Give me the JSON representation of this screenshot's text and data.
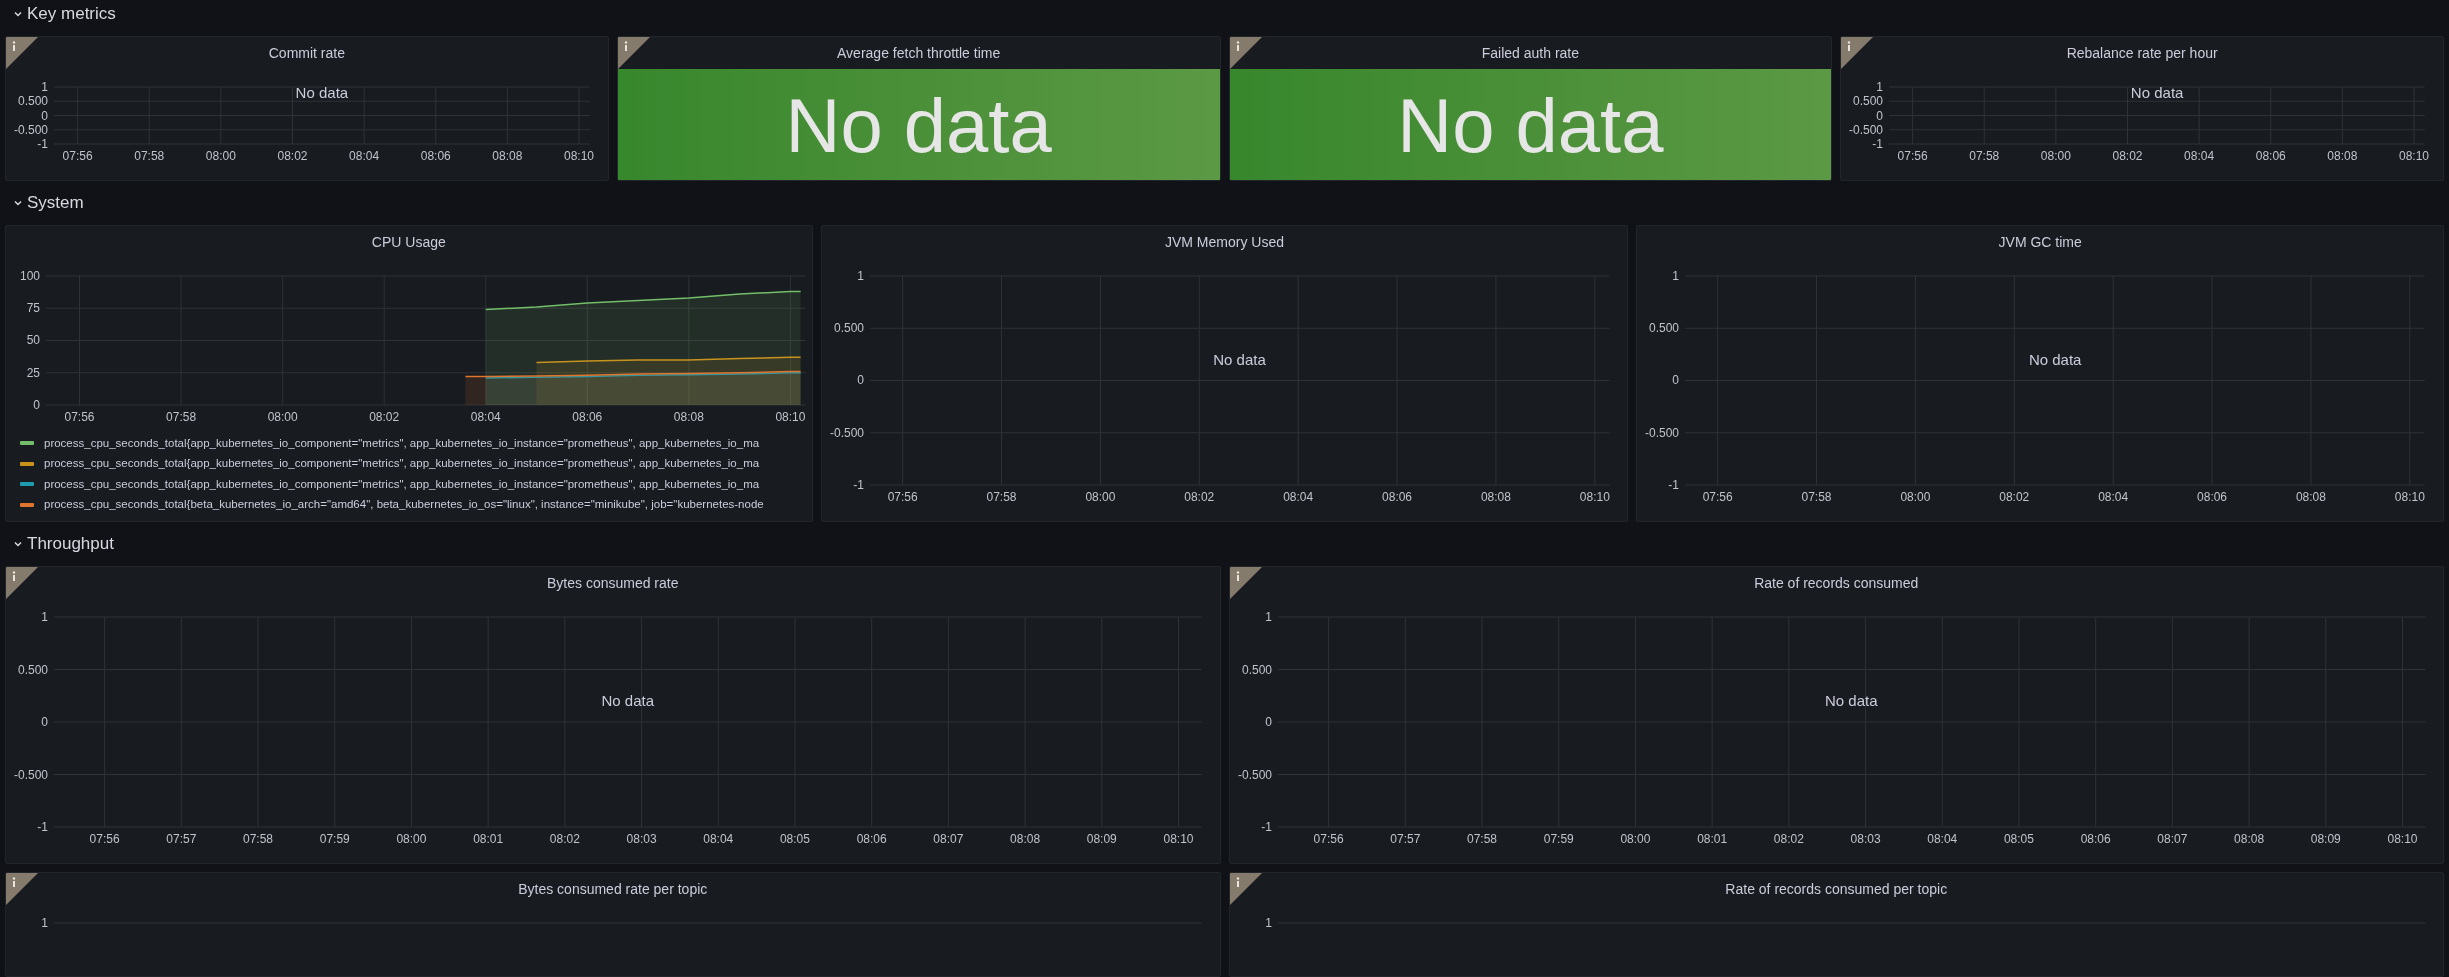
{
  "rows": [
    {
      "title": "Key metrics",
      "expanded": true,
      "panels": [
        {
          "kind": "graph",
          "title": "Commit rate",
          "info": true,
          "message": "No data",
          "chart_data": {
            "grid": true,
            "type": "line",
            "xlim": [
              475.34,
              490.3
            ],
            "ylim": [
              -1,
              1
            ],
            "xticks": [
              {
                "value": 476,
                "label": "07:56"
              },
              {
                "value": 478,
                "label": "07:58"
              },
              {
                "value": 480,
                "label": "08:00"
              },
              {
                "value": 482,
                "label": "08:02"
              },
              {
                "value": 484,
                "label": "08:04"
              },
              {
                "value": 486,
                "label": "08:06"
              },
              {
                "value": 488,
                "label": "08:08"
              },
              {
                "value": 490,
                "label": "08:10"
              }
            ],
            "yticks": [
              {
                "value": 1,
                "label": "1"
              },
              {
                "value": 0.5,
                "label": "0.500"
              },
              {
                "value": 0,
                "label": "0"
              },
              {
                "value": -0.5,
                "label": "-0.500"
              },
              {
                "value": -1,
                "label": "-1"
              }
            ]
          }
        },
        {
          "kind": "stat",
          "title": "Average fetch throttle time",
          "info": true,
          "value": "No data"
        },
        {
          "kind": "stat",
          "title": "Failed auth rate",
          "info": true,
          "value": "No data"
        },
        {
          "kind": "graph",
          "title": "Rebalance rate per hour",
          "info": true,
          "message": "No data",
          "chart_data": {
            "grid": true,
            "type": "line",
            "xlim": [
              475.34,
              490.3
            ],
            "ylim": [
              -1,
              1
            ],
            "xticks": [
              {
                "value": 476,
                "label": "07:56"
              },
              {
                "value": 478,
                "label": "07:58"
              },
              {
                "value": 480,
                "label": "08:00"
              },
              {
                "value": 482,
                "label": "08:02"
              },
              {
                "value": 484,
                "label": "08:04"
              },
              {
                "value": 486,
                "label": "08:06"
              },
              {
                "value": 488,
                "label": "08:08"
              },
              {
                "value": 490,
                "label": "08:10"
              }
            ],
            "yticks": [
              {
                "value": 1,
                "label": "1"
              },
              {
                "value": 0.5,
                "label": "0.500"
              },
              {
                "value": 0,
                "label": "0"
              },
              {
                "value": -0.5,
                "label": "-0.500"
              },
              {
                "value": -1,
                "label": "-1"
              }
            ]
          }
        }
      ]
    },
    {
      "title": "System",
      "expanded": true,
      "panels": [
        {
          "kind": "graph",
          "title": "CPU Usage",
          "info": false,
          "chart_data": {
            "grid": true,
            "type": "area",
            "xlim": [
              475.34,
              490.3
            ],
            "ylim": [
              0,
              100
            ],
            "x": [
              483.6,
              484,
              485,
              486,
              487,
              488,
              489,
              490,
              490.2
            ],
            "series": [
              {
                "name": "process_cpu_seconds_total{app_kubernetes_io_component=\"metrics\", app_kubernetes_io_instance=\"prometheus\", app_kubernetes_io_ma",
                "color": "#73bf69",
                "values": [
                  null,
                  74,
                  76,
                  79,
                  81,
                  83,
                  86,
                  88,
                  88
                ]
              },
              {
                "name": "process_cpu_seconds_total{app_kubernetes_io_component=\"metrics\", app_kubernetes_io_instance=\"prometheus\", app_kubernetes_io_ma",
                "color": "#c8931d",
                "values": [
                  null,
                  null,
                  33,
                  34,
                  35,
                  35,
                  36,
                  37,
                  37
                ]
              },
              {
                "name": "process_cpu_seconds_total{app_kubernetes_io_component=\"metrics\", app_kubernetes_io_instance=\"prometheus\", app_kubernetes_io_ma",
                "color": "#1f9bb0",
                "values": [
                  null,
                  21,
                  21.5,
                  22,
                  23,
                  23.5,
                  24,
                  25,
                  25
                ]
              },
              {
                "name": "process_cpu_seconds_total{beta_kubernetes_io_arch=\"amd64\", beta_kubernetes_io_os=\"linux\", instance=\"minikube\", job=\"kubernetes-node",
                "color": "#e0752d",
                "values": [
                  22,
                  22,
                  22.5,
                  23,
                  24,
                  24.5,
                  25,
                  26,
                  26
                ]
              }
            ],
            "xticks": [
              {
                "value": 476,
                "label": "07:56"
              },
              {
                "value": 478,
                "label": "07:58"
              },
              {
                "value": 480,
                "label": "08:00"
              },
              {
                "value": 482,
                "label": "08:02"
              },
              {
                "value": 484,
                "label": "08:04"
              },
              {
                "value": 486,
                "label": "08:06"
              },
              {
                "value": 488,
                "label": "08:08"
              },
              {
                "value": 490,
                "label": "08:10"
              }
            ],
            "yticks": [
              100,
              75,
              50,
              25,
              0
            ]
          }
        },
        {
          "kind": "graph",
          "title": "JVM Memory Used",
          "info": false,
          "message": "No data",
          "chart_data": {
            "grid": true,
            "type": "line",
            "xlim": [
              475.34,
              490.3
            ],
            "ylim": [
              -1,
              1
            ],
            "xticks": [
              {
                "value": 476,
                "label": "07:56"
              },
              {
                "value": 478,
                "label": "07:58"
              },
              {
                "value": 480,
                "label": "08:00"
              },
              {
                "value": 482,
                "label": "08:02"
              },
              {
                "value": 484,
                "label": "08:04"
              },
              {
                "value": 486,
                "label": "08:06"
              },
              {
                "value": 488,
                "label": "08:08"
              },
              {
                "value": 490,
                "label": "08:10"
              }
            ],
            "yticks": [
              {
                "value": 1,
                "label": "1"
              },
              {
                "value": 0.5,
                "label": "0.500"
              },
              {
                "value": 0,
                "label": "0"
              },
              {
                "value": -0.5,
                "label": "-0.500"
              },
              {
                "value": -1,
                "label": "-1"
              }
            ]
          }
        },
        {
          "kind": "graph",
          "title": "JVM GC time",
          "info": false,
          "message": "No data",
          "chart_data": {
            "grid": true,
            "type": "line",
            "xlim": [
              475.34,
              490.3
            ],
            "ylim": [
              -1,
              1
            ],
            "xticks": [
              {
                "value": 476,
                "label": "07:56"
              },
              {
                "value": 478,
                "label": "07:58"
              },
              {
                "value": 480,
                "label": "08:00"
              },
              {
                "value": 482,
                "label": "08:02"
              },
              {
                "value": 484,
                "label": "08:04"
              },
              {
                "value": 486,
                "label": "08:06"
              },
              {
                "value": 488,
                "label": "08:08"
              },
              {
                "value": 490,
                "label": "08:10"
              }
            ],
            "yticks": [
              {
                "value": 1,
                "label": "1"
              },
              {
                "value": 0.5,
                "label": "0.500"
              },
              {
                "value": 0,
                "label": "0"
              },
              {
                "value": -0.5,
                "label": "-0.500"
              },
              {
                "value": -1,
                "label": "-1"
              }
            ]
          }
        }
      ]
    },
    {
      "title": "Throughput",
      "expanded": true,
      "panels": [
        {
          "kind": "graph",
          "title": "Bytes consumed rate",
          "info": true,
          "message": "No data",
          "chart_data": {
            "grid": true,
            "type": "line",
            "xlim": [
              475.34,
              490.3
            ],
            "ylim": [
              -1,
              1
            ],
            "xticks": [
              {
                "value": 476,
                "label": "07:56"
              },
              {
                "value": 477,
                "label": "07:57"
              },
              {
                "value": 478,
                "label": "07:58"
              },
              {
                "value": 479,
                "label": "07:59"
              },
              {
                "value": 480,
                "label": "08:00"
              },
              {
                "value": 481,
                "label": "08:01"
              },
              {
                "value": 482,
                "label": "08:02"
              },
              {
                "value": 483,
                "label": "08:03"
              },
              {
                "value": 484,
                "label": "08:04"
              },
              {
                "value": 485,
                "label": "08:05"
              },
              {
                "value": 486,
                "label": "08:06"
              },
              {
                "value": 487,
                "label": "08:07"
              },
              {
                "value": 488,
                "label": "08:08"
              },
              {
                "value": 489,
                "label": "08:09"
              },
              {
                "value": 490,
                "label": "08:10"
              }
            ],
            "yticks": [
              {
                "value": 1,
                "label": "1"
              },
              {
                "value": 0.5,
                "label": "0.500"
              },
              {
                "value": 0,
                "label": "0"
              },
              {
                "value": -0.5,
                "label": "-0.500"
              },
              {
                "value": -1,
                "label": "-1"
              }
            ]
          }
        },
        {
          "kind": "graph",
          "title": "Rate of records consumed",
          "info": true,
          "message": "No data",
          "chart_data": {
            "grid": true,
            "type": "line",
            "xlim": [
              475.34,
              490.3
            ],
            "ylim": [
              -1,
              1
            ],
            "xticks": [
              {
                "value": 476,
                "label": "07:56"
              },
              {
                "value": 477,
                "label": "07:57"
              },
              {
                "value": 478,
                "label": "07:58"
              },
              {
                "value": 479,
                "label": "07:59"
              },
              {
                "value": 480,
                "label": "08:00"
              },
              {
                "value": 481,
                "label": "08:01"
              },
              {
                "value": 482,
                "label": "08:02"
              },
              {
                "value": 483,
                "label": "08:03"
              },
              {
                "value": 484,
                "label": "08:04"
              },
              {
                "value": 485,
                "label": "08:05"
              },
              {
                "value": 486,
                "label": "08:06"
              },
              {
                "value": 487,
                "label": "08:07"
              },
              {
                "value": 488,
                "label": "08:08"
              },
              {
                "value": 489,
                "label": "08:09"
              },
              {
                "value": 490,
                "label": "08:10"
              }
            ],
            "yticks": [
              {
                "value": 1,
                "label": "1"
              },
              {
                "value": 0.5,
                "label": "0.500"
              },
              {
                "value": 0,
                "label": "0"
              },
              {
                "value": -0.5,
                "label": "-0.500"
              },
              {
                "value": -1,
                "label": "-1"
              }
            ]
          }
        }
      ]
    },
    {
      "panels": [
        {
          "kind": "graph",
          "title": "Bytes consumed rate per topic",
          "info": true,
          "chart_data": {
            "type": "other",
            "annotations": [
              "1"
            ]
          }
        },
        {
          "kind": "graph",
          "title": "Rate of records consumed per topic",
          "info": true,
          "chart_data": {
            "type": "other",
            "annotations": [
              "1"
            ]
          }
        }
      ]
    }
  ]
}
